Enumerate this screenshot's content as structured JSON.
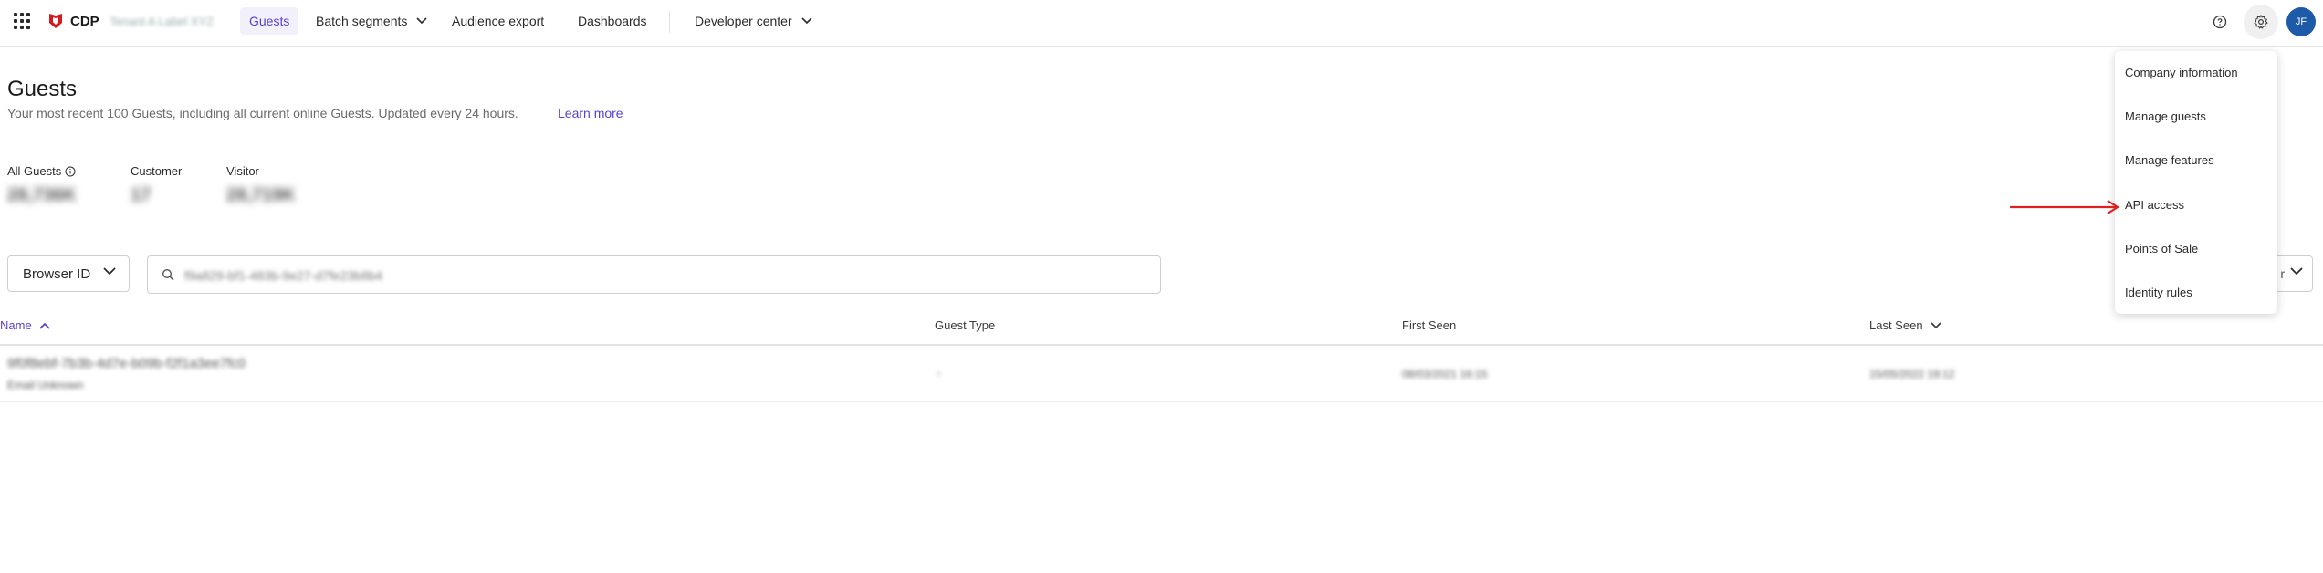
{
  "header": {
    "brand": "CDP",
    "tenant": "Tenant A Label XYZ",
    "nav": [
      {
        "label": "Guests",
        "active": true
      },
      {
        "label": "Batch segments",
        "has_dropdown": true
      },
      {
        "label": "Audience export"
      },
      {
        "label": "Dashboards"
      },
      {
        "label": "Developer center",
        "has_dropdown": true
      }
    ],
    "avatar_initials": "JF",
    "icons": [
      "apps-grid-icon",
      "help-icon",
      "gear-icon"
    ]
  },
  "page": {
    "title": "Guests",
    "subtitle": "Your most recent 100 Guests, including all current online Guests. Updated every 24 hours.",
    "learn_more": "Learn more"
  },
  "stats": [
    {
      "label": "All Guests",
      "value": "28,736K"
    },
    {
      "label": "Customer",
      "value": "17"
    },
    {
      "label": "Visitor",
      "value": "28,719K"
    }
  ],
  "filter": {
    "select_value": "Browser ID",
    "search_value": "f9a829-bf1-483b-9e27-d7fe23b8b4"
  },
  "table": {
    "columns": [
      "Name",
      "Guest Type",
      "First Seen",
      "Last Seen"
    ],
    "rows": [
      {
        "name": "9f0f8ebf-7b3b-4d7e-b09b-f2f1a3ee7fc0",
        "email": "Email Unknown",
        "guest_type": "-",
        "first_seen": "08/03/2021 16:15",
        "last_seen": "15/05/2022 19:12"
      }
    ]
  },
  "settings_menu": {
    "items": [
      "Company information",
      "Manage guests",
      "Manage features",
      "API access",
      "Points of Sale",
      "Identity rules"
    ]
  },
  "colors": {
    "accent": "#5b3fd1",
    "avatar": "#1d5ba8",
    "arrow": "#e02020"
  }
}
